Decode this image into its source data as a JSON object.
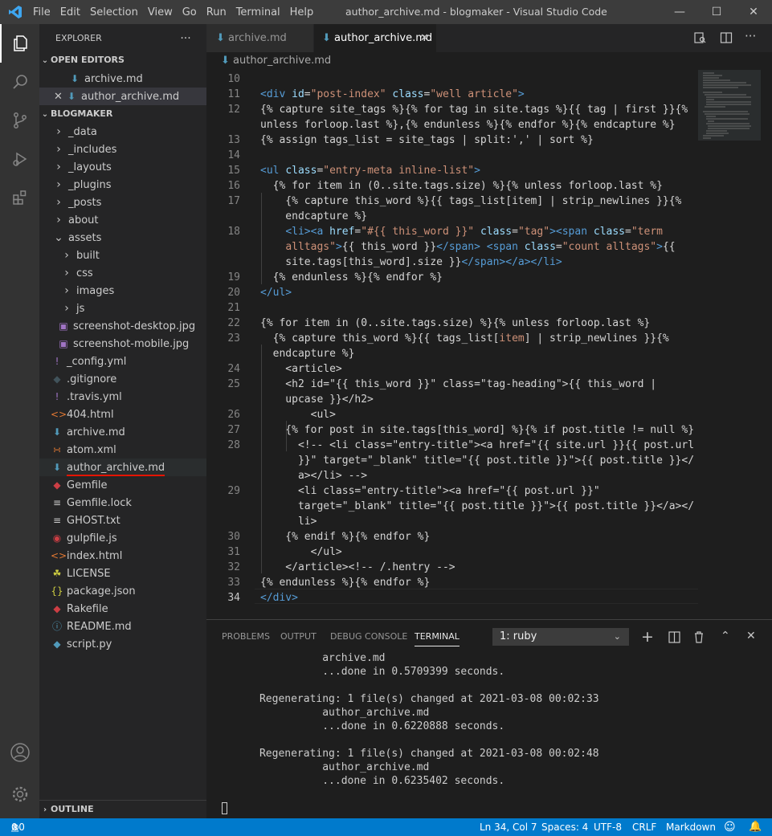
{
  "window": {
    "title": "author_archive.md - blogmaker - Visual Studio Code",
    "menu": [
      "File",
      "Edit",
      "Selection",
      "View",
      "Go",
      "Run",
      "Terminal",
      "Help"
    ]
  },
  "sidebar": {
    "header": "EXPLORER",
    "open_editors_label": "OPEN EDITORS",
    "open_editors": [
      "archive.md",
      "author_archive.md"
    ],
    "project_label": "BLOGMAKER",
    "tree": [
      {
        "label": "_data",
        "type": "folder"
      },
      {
        "label": "_includes",
        "type": "folder"
      },
      {
        "label": "_layouts",
        "type": "folder"
      },
      {
        "label": "_plugins",
        "type": "folder"
      },
      {
        "label": "_posts",
        "type": "folder"
      },
      {
        "label": "about",
        "type": "folder"
      },
      {
        "label": "assets",
        "type": "folder-open"
      },
      {
        "label": "built",
        "type": "subfolder"
      },
      {
        "label": "css",
        "type": "subfolder"
      },
      {
        "label": "images",
        "type": "subfolder"
      },
      {
        "label": "js",
        "type": "subfolder"
      },
      {
        "label": "screenshot-desktop.jpg",
        "type": "image"
      },
      {
        "label": "screenshot-mobile.jpg",
        "type": "image"
      },
      {
        "label": "_config.yml",
        "type": "yml"
      },
      {
        "label": ".gitignore",
        "type": "git"
      },
      {
        "label": ".travis.yml",
        "type": "yml"
      },
      {
        "label": "404.html",
        "type": "html"
      },
      {
        "label": "archive.md",
        "type": "md"
      },
      {
        "label": "atom.xml",
        "type": "xml"
      },
      {
        "label": "author_archive.md",
        "type": "md"
      },
      {
        "label": "Gemfile",
        "type": "ruby"
      },
      {
        "label": "Gemfile.lock",
        "type": "text"
      },
      {
        "label": "GHOST.txt",
        "type": "text"
      },
      {
        "label": "gulpfile.js",
        "type": "gulp"
      },
      {
        "label": "index.html",
        "type": "html"
      },
      {
        "label": "LICENSE",
        "type": "license"
      },
      {
        "label": "package.json",
        "type": "json"
      },
      {
        "label": "Rakefile",
        "type": "ruby"
      },
      {
        "label": "README.md",
        "type": "info"
      },
      {
        "label": "script.py",
        "type": "python"
      }
    ],
    "outline_label": "OUTLINE"
  },
  "editor": {
    "tabs": [
      "archive.md",
      "author_archive.md"
    ],
    "breadcrumb": "author_archive.md",
    "lines": [
      {
        "n": "10",
        "html": ""
      },
      {
        "n": "11",
        "html": "<span class='t'>&lt;div</span> <span class='a'>id</span>=<span class='s'>\"post-index\"</span> <span class='a'>class</span>=<span class='s'>\"well article\"</span><span class='t'>&gt;</span>"
      },
      {
        "n": "12",
        "html": "{% capture site_tags %}{% for tag in site.tags %}{{ tag | first }}{%"
      },
      {
        "n": "",
        "html": "unless forloop.last %},{% endunless %}{% endfor %}{% endcapture %}"
      },
      {
        "n": "13",
        "html": "{% assign tags_list = site_tags | split:',' | sort %}"
      },
      {
        "n": "14",
        "html": ""
      },
      {
        "n": "15",
        "html": "<span class='t'>&lt;ul</span> <span class='a'>class</span>=<span class='s'>\"entry-meta inline-list\"</span><span class='t'>&gt;</span>"
      },
      {
        "n": "16",
        "html": "  {% for item in (0..site.tags.size) %}{% unless forloop.last %}"
      },
      {
        "n": "17",
        "html": "    {% capture this_word %}{{ tags_list[item] | strip_newlines }}{%"
      },
      {
        "n": "",
        "html": "    endcapture %}"
      },
      {
        "n": "18",
        "html": "    <span class='t'>&lt;li&gt;&lt;a</span> <span class='a'>href</span>=<span class='s'>\"#{{ this_word }}\"</span> <span class='a'>class</span>=<span class='s'>\"tag\"</span><span class='t'>&gt;&lt;span</span> <span class='a'>class</span>=<span class='s'>\"term</span>"
      },
      {
        "n": "",
        "html": "    <span class='s'>alltags\"</span><span class='t'>&gt;</span>{{ this_word }}<span class='t'>&lt;/span&gt;</span> <span class='t'>&lt;span</span> <span class='a'>class</span>=<span class='s'>\"count alltags\"</span><span class='t'>&gt;</span>{{"
      },
      {
        "n": "",
        "html": "    site.tags[this_word].size }}<span class='t'>&lt;/span&gt;&lt;/a&gt;&lt;/li&gt;</span>"
      },
      {
        "n": "19",
        "html": "  {% endunless %}{% endfor %}"
      },
      {
        "n": "20",
        "html": "<span class='t'>&lt;/ul&gt;</span>"
      },
      {
        "n": "21",
        "html": ""
      },
      {
        "n": "22",
        "html": "{% for item in (0..site.tags.size) %}{% unless forloop.last %}"
      },
      {
        "n": "23",
        "html": "  {% capture this_word %}{{ tags_list[<span class='s'>item</span>] | strip_newlines }}{%"
      },
      {
        "n": "",
        "html": "  endcapture %}"
      },
      {
        "n": "24",
        "html": "    &lt;article&gt;"
      },
      {
        "n": "25",
        "html": "    &lt;h2 id=\"{{ this_word }}\" class=\"tag-heading\"&gt;{{ this_word |"
      },
      {
        "n": "",
        "html": "    upcase }}&lt;/h2&gt;"
      },
      {
        "n": "26",
        "html": "        &lt;ul&gt;"
      },
      {
        "n": "27",
        "html": "    {% for post in site.tags[this_word] %}{% if post.title != null %}"
      },
      {
        "n": "28",
        "html": "      &lt;!-- &lt;li class=\"entry-title\"&gt;&lt;a href=\"{{ site.url }}{{ post.url"
      },
      {
        "n": "",
        "html": "      }}\" target=\"_blank\" title=\"{{ post.title }}\"&gt;{{ post.title }}&lt;/"
      },
      {
        "n": "",
        "html": "      a&gt;&lt;/li&gt; --&gt;"
      },
      {
        "n": "29",
        "html": "      &lt;li class=\"entry-title\"&gt;&lt;a href=\"{{ post.url }}\""
      },
      {
        "n": "",
        "html": "      target=\"_blank\" title=\"{{ post.title }}\"&gt;{{ post.title }}&lt;/a&gt;&lt;/"
      },
      {
        "n": "",
        "html": "      li&gt;"
      },
      {
        "n": "30",
        "html": "    {% endif %}{% endfor %}"
      },
      {
        "n": "31",
        "html": "        &lt;/ul&gt;"
      },
      {
        "n": "32",
        "html": "    &lt;/article&gt;&lt;!-- /.hentry --&gt;"
      },
      {
        "n": "33",
        "html": "{% endunless %}{% endfor %}"
      },
      {
        "n": "34",
        "html": "<span class='t'>&lt;/div&gt;</span>"
      }
    ]
  },
  "panel": {
    "tabs": [
      "PROBLEMS",
      "OUTPUT",
      "DEBUG CONSOLE",
      "TERMINAL"
    ],
    "terminal_select": "1: ruby",
    "terminal_lines": [
      "                archive.md",
      "                ...done in 0.5709399 seconds.",
      "",
      "      Regenerating: 1 file(s) changed at 2021-03-08 00:02:33",
      "                author_archive.md",
      "                ...done in 0.6220888 seconds.",
      "",
      "      Regenerating: 1 file(s) changed at 2021-03-08 00:02:48",
      "                author_archive.md",
      "                ...done in 0.6235402 seconds."
    ]
  },
  "status": {
    "errors": "0",
    "warnings": "0",
    "position": "Ln 34, Col 7",
    "spaces": "Spaces: 4",
    "encoding": "UTF-8",
    "eol": "CRLF",
    "language": "Markdown"
  },
  "colors": {
    "accent": "#007acc",
    "activity_bar": "#333333",
    "sidebar": "#252526",
    "editor": "#1e1e1e",
    "underline": "#e51400"
  }
}
